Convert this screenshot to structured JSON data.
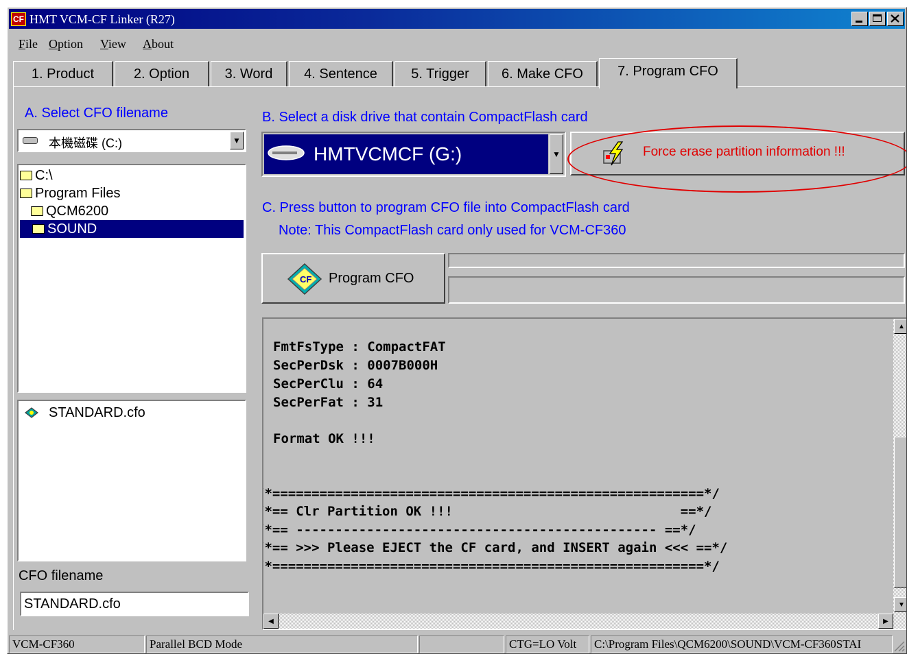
{
  "window": {
    "title": "HMT VCM-CF Linker (R27)",
    "app_icon": "CF"
  },
  "menu": [
    "File",
    "Option",
    "View",
    "About"
  ],
  "tabs": [
    "1. Product",
    "2. Option",
    "3. Word",
    "4. Sentence",
    "5. Trigger",
    "6. Make CFO",
    "7. Program CFO"
  ],
  "sectionA": {
    "label": "A.  Select CFO filename",
    "drive": "本機磁碟 (C:)",
    "folders": [
      "C:\\",
      "Program Files",
      "QCM6200",
      "SOUND"
    ],
    "files": [
      "STANDARD.cfo"
    ],
    "filename_label": "CFO filename",
    "filename_value": "STANDARD.cfo"
  },
  "sectionB": {
    "label": "B. Select a disk drive that contain CompactFlash card",
    "drive": "HMTVCMCF (G:)",
    "force_erase": "Force erase partition information !!!"
  },
  "sectionC": {
    "label": "C. Press button to program CFO file into CompactFlash card",
    "note": "Note: This CompactFlash card only used for VCM-CF360",
    "program_button": "Program CFO"
  },
  "log": [
    "FmtFsType : CompactFAT",
    "SecPerDsk : 0007B000H",
    "SecPerClu : 64",
    "SecPerFat : 31",
    "",
    "Format OK !!!",
    "",
    "",
    "/*=======================================================*/",
    "/*== Clr Partition OK !!!                             ==*/",
    "/*== ---------------------------------------------- ==*/",
    "/*== >>> Please EJECT the CF card, and INSERT again <<< ==*/",
    "/*=======================================================*/"
  ],
  "status": {
    "model": "VCM-CF360",
    "mode": "Parallel BCD Mode",
    "empty": "",
    "ctg": "CTG=LO Volt",
    "path": "C:\\Program Files\\QCM6200\\SOUND\\VCM-CF360STAI"
  },
  "colors": {
    "accent": "#0000ff",
    "title_bar": "#000080",
    "warning": "#e00000",
    "face": "#c0c0c0"
  }
}
